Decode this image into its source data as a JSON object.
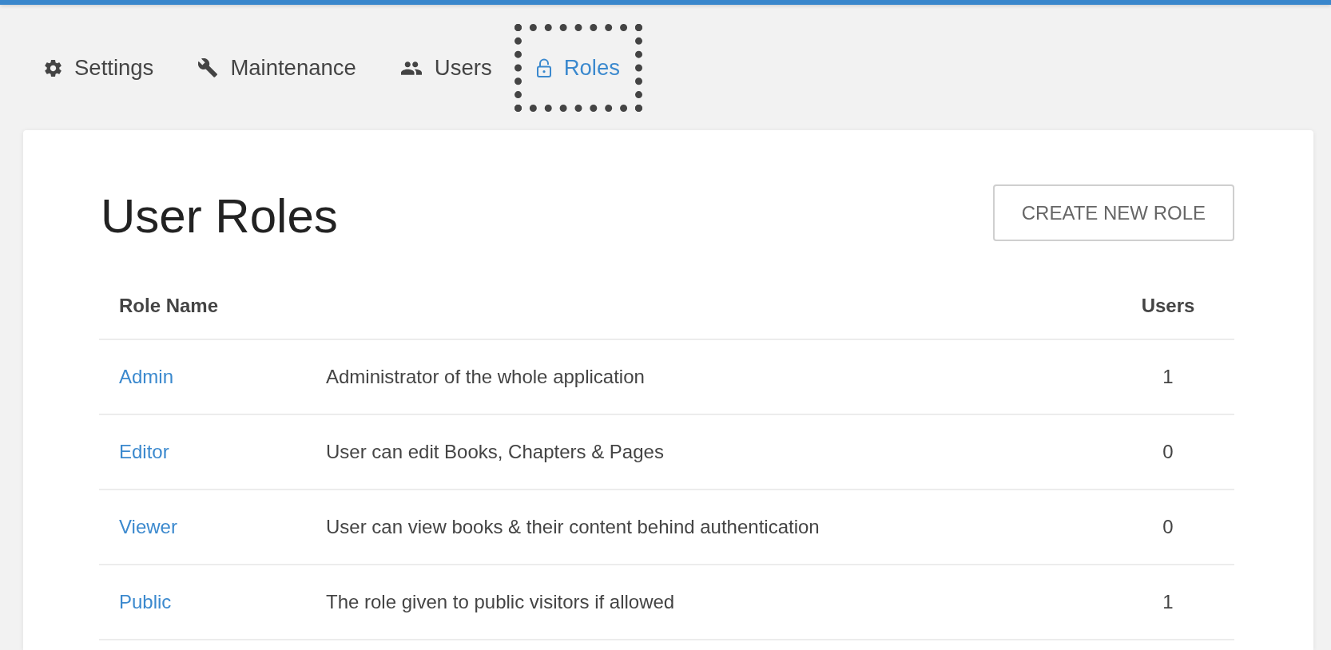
{
  "nav": {
    "tabs": [
      {
        "label": "Settings",
        "selected": false,
        "focused": false
      },
      {
        "label": "Maintenance",
        "selected": false,
        "focused": false
      },
      {
        "label": "Users",
        "selected": false,
        "focused": false
      },
      {
        "label": "Roles",
        "selected": true,
        "focused": true
      }
    ]
  },
  "page": {
    "title": "User Roles",
    "create_button": "CREATE NEW ROLE"
  },
  "table": {
    "columns": {
      "name": "Role Name",
      "users": "Users"
    },
    "rows": [
      {
        "name": "Admin",
        "description": "Administrator of the whole application",
        "users": "1"
      },
      {
        "name": "Editor",
        "description": "User can edit Books, Chapters & Pages",
        "users": "0"
      },
      {
        "name": "Viewer",
        "description": "User can view books & their content behind authentication",
        "users": "0"
      },
      {
        "name": "Public",
        "description": "The role given to public visitors if allowed",
        "users": "1"
      }
    ]
  }
}
